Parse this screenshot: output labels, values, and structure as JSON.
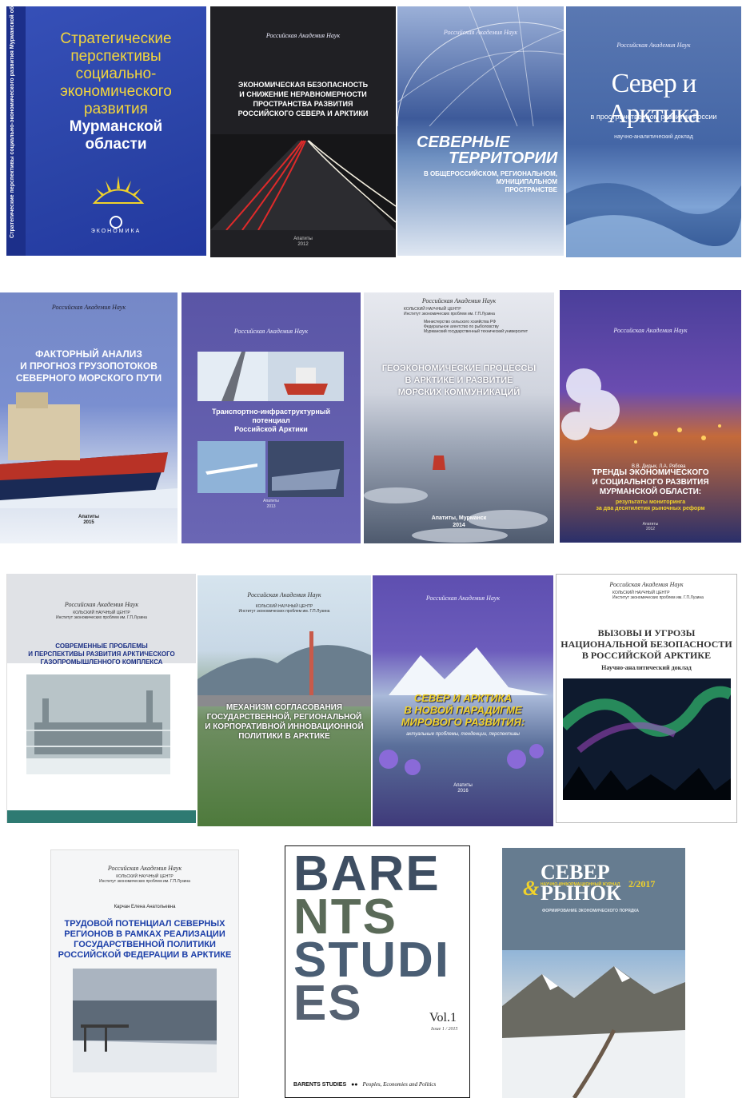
{
  "colors": {
    "blue_cover": "#2b45a8",
    "dark_cover": "#1b1b1f",
    "purple_cover": "#5b5aa8",
    "teal": "#2e7a72",
    "accent_yellow": "#f1d22a"
  },
  "covers": [
    {
      "title": "Стратегические перспективы социально-экономического развития Мурманской области",
      "title_lines": [
        "Стратегические",
        "перспективы",
        "социально-",
        "экономического",
        "развития"
      ],
      "title_bold": [
        "Мурманской",
        "области"
      ],
      "spine": "Стратегические перспективы социально-экономического развития Мурманской области",
      "publisher": "ЭКОНОМИКА"
    },
    {
      "header": "Российская Академия Наук",
      "title_lines": [
        "ЭКОНОМИЧЕСКАЯ БЕЗОПАСНОСТЬ",
        "И СНИЖЕНИЕ НЕРАВНОМЕРНОСТИ",
        "ПРОСТРАНСТВА РАЗВИТИЯ",
        "РОССИЙСКОГО СЕВЕРА И АРКТИКИ"
      ],
      "city": "Апатиты",
      "year": "2012"
    },
    {
      "header": "Российская Академия Наук",
      "title_lines": [
        "СЕВЕРНЫЕ",
        "ТЕРРИТОРИИ"
      ],
      "subtitle_lines": [
        "В ОБЩЕРОССИЙСКОМ, РЕГИОНАЛЬНОМ,",
        "МУНИЦИПАЛЬНОМ",
        "ПРОСТРАНСТВЕ"
      ]
    },
    {
      "header": "Российская Академия Наук",
      "title": "Север и Арктика",
      "subtitle": "в пространственном развитии России",
      "note": "научно-аналитический доклад"
    },
    {
      "header": "Российская Академия Наук",
      "title_lines": [
        "ФАКТОРНЫЙ АНАЛИЗ",
        "И ПРОГНОЗ ГРУЗОПОТОКОВ",
        "СЕВЕРНОГО МОРСКОГО ПУТИ"
      ],
      "city": "Апатиты",
      "year": "2015"
    },
    {
      "header": "Российская Академия Наук",
      "title_lines": [
        "Транспортно-инфраструктурный",
        "потенциал",
        "Российской Арктики"
      ],
      "city": "Апатиты",
      "year": "2013"
    },
    {
      "header": "Российская Академия Наук",
      "org_lines": [
        "КОЛЬСКИЙ НАУЧНЫЙ ЦЕНТР",
        "Институт экономических проблем им. Г.П.Лузина"
      ],
      "ministry_lines": [
        "Министерство сельского хозяйства РФ",
        "Федеральное агентство по рыболовству",
        "Мурманский государственный технический университет"
      ],
      "title_lines": [
        "ГЕОЭКОНОМИЧЕСКИЕ ПРОЦЕССЫ",
        "В АРКТИКЕ И РАЗВИТИЕ",
        "МОРСКИХ КОММУНИКАЦИЙ"
      ],
      "city": "Апатиты, Мурманск",
      "year": "2014"
    },
    {
      "header": "Российская Академия Наук",
      "authors": "В.В. Дидык, Л.А. Рябова",
      "title_lines": [
        "ТРЕНДЫ ЭКОНОМИЧЕСКОГО",
        "И СОЦИАЛЬНОГО РАЗВИТИЯ",
        "МУРМАНСКОЙ ОБЛАСТИ:"
      ],
      "subtitle_lines": [
        "результаты мониторинга",
        "за два десятилетия рыночных реформ"
      ],
      "city": "Апатиты",
      "year": "2012"
    },
    {
      "header": "Российская Академия Наук",
      "org_lines": [
        "КОЛЬСКИЙ НАУЧНЫЙ ЦЕНТР",
        "Институт экономических проблем им. Г.П.Лузина"
      ],
      "title_lines": [
        "СОВРЕМЕННЫЕ ПРОБЛЕМЫ",
        "И ПЕРСПЕКТИВЫ РАЗВИТИЯ АРКТИЧЕСКОГО",
        "ГАЗОПРОМЫШЛЕННОГО КОМПЛЕКСА"
      ]
    },
    {
      "header": "Российская Академия Наук",
      "org_lines": [
        "КОЛЬСКИЙ НАУЧНЫЙ ЦЕНТР",
        "Институт экономических проблем им. Г.П.Лузина"
      ],
      "title_lines": [
        "МЕХАНИЗМ СОГЛАСОВАНИЯ",
        "ГОСУДАРСТВЕННОЙ, РЕГИОНАЛЬНОЙ",
        "И КОРПОРАТИВНОЙ ИННОВАЦИОННОЙ",
        "ПОЛИТИКИ В АРКТИКЕ"
      ]
    },
    {
      "header": "Российская Академия Наук",
      "title_lines": [
        "СЕВЕР И АРКТИКА",
        "В НОВОЙ ПАРАДИГМЕ",
        "МИРОВОГО РАЗВИТИЯ:"
      ],
      "subtitle": "актуальные проблемы, тенденции, перспективы",
      "city": "Апатиты",
      "year": "2016"
    },
    {
      "header": "Российская Академия Наук",
      "org_lines": [
        "КОЛЬСКИЙ НАУЧНЫЙ ЦЕНТР",
        "Институт экономических проблем им. Г.П.Лузина"
      ],
      "title_lines": [
        "ВЫЗОВЫ И УГРОЗЫ",
        "НАЦИОНАЛЬНОЙ БЕЗОПАСНОСТИ",
        "В РОССИЙСКОЙ АРКТИКЕ"
      ],
      "note": "Научно-аналитический доклад"
    },
    {
      "header": "Российская Академия Наук",
      "org_lines": [
        "КОЛЬСКИЙ НАУЧНЫЙ ЦЕНТР",
        "Институт экономических проблем им. Г.П.Лузина"
      ],
      "author": "Карчан Елена Анатольевна",
      "title_lines": [
        "ТРУДОВОЙ ПОТЕНЦИАЛ СЕВЕРНЫХ",
        "РЕГИОНОВ В РАМКАХ РЕАЛИЗАЦИИ",
        "ГОСУДАРСТВЕННОЙ ПОЛИТИКИ",
        "РОССИЙСКОЙ ФЕДЕРАЦИИ В АРКТИКЕ"
      ]
    },
    {
      "big_lines": [
        "BARE",
        "NTS",
        "STUDI",
        "ES"
      ],
      "volume": "Vol.1",
      "issue": "Issue 1 / 2015",
      "footer_title": "BARENTS STUDIES",
      "footer_sub": "Peoples, Economies and Politics"
    },
    {
      "title_top": "СЕВЕР",
      "amp": "&",
      "title_bottom": "РЫНОК",
      "journal": "НАУЧНО-ИНФОРМАЦИОННЫЙ ЖУРНАЛ",
      "issue": "2/2017",
      "tagline": "ФОРМИРОВАНИЕ ЭКОНОМИЧЕСКОГО ПОРЯДКА"
    }
  ]
}
